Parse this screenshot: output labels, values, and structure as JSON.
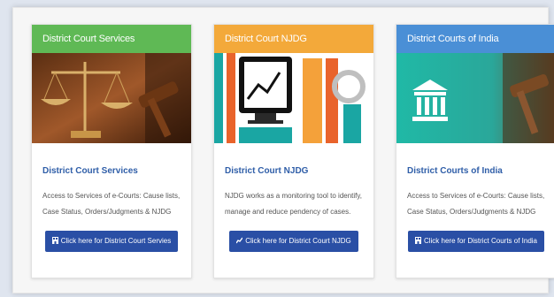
{
  "colors": {
    "background": "#dfe5ef",
    "card_header_1": "#5fb955",
    "card_header_2": "#f3a93a",
    "card_header_3": "#4a8fd6",
    "title_text": "#2f5ea8",
    "button": "#2a4fa5"
  },
  "cards": [
    {
      "header": "District Court Services",
      "image_icon": "justice-scales-gavel-image",
      "title": "District Court Services",
      "description": "Access to Services of e-Courts: Cause lists, Case Status, Orders/Judgments & NJDG",
      "button_label": "Click here for District Court Servies",
      "button_icon": "building-icon"
    },
    {
      "header": "District Court NJDG",
      "image_icon": "monitoring-chart-image",
      "title": "District Court NJDG",
      "description": "NJDG works as a monitoring tool to identify, manage and reduce pendency of cases.",
      "button_label": "Click here for District Court NJDG",
      "button_icon": "chart-icon"
    },
    {
      "header": "District Courts of India",
      "image_icon": "courthouse-gavel-image",
      "title": "District Courts of India",
      "description": "Access to Services of e-Courts: Cause lists, Case Status, Orders/Judgments & NJDG",
      "button_label": "Click here for District Courts of India",
      "button_icon": "building-icon"
    }
  ]
}
